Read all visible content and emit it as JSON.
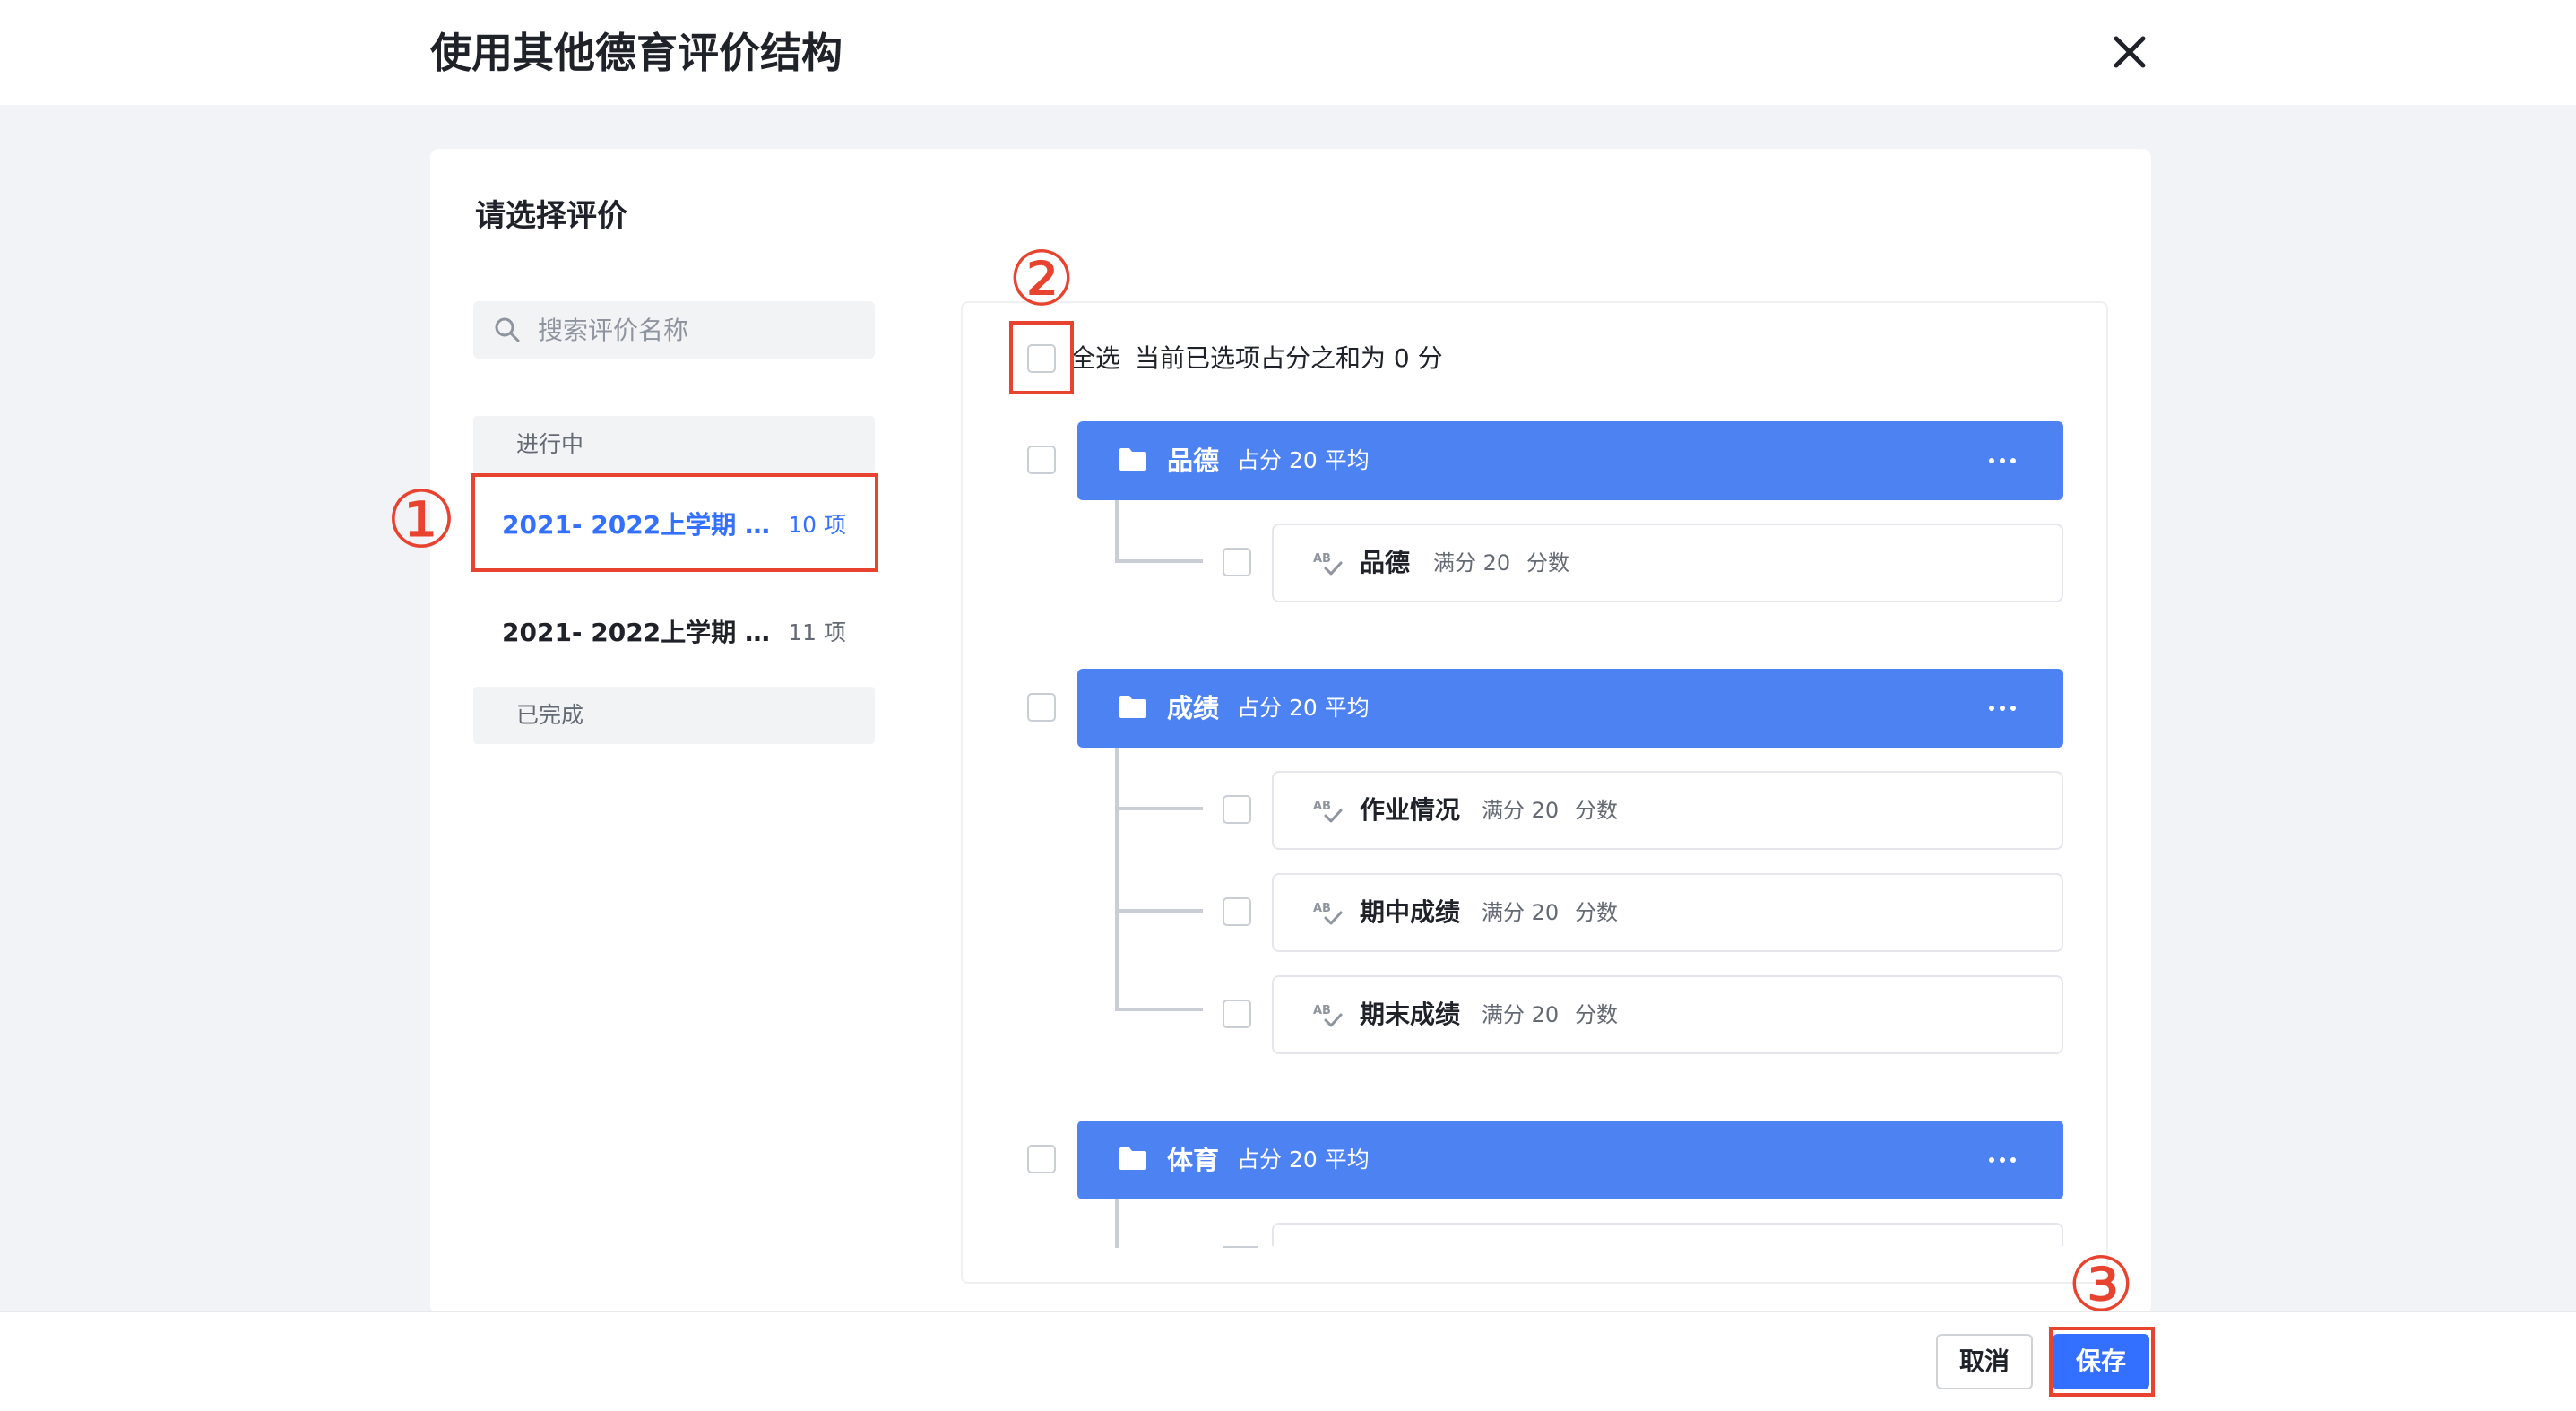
{
  "dialog": {
    "title": "使用其他德育评价结构",
    "close_icon": "close-icon"
  },
  "panel": {
    "title": "请选择评价",
    "search_placeholder": "搜索评价名称"
  },
  "eval_list": {
    "in_progress_label": "进行中",
    "completed_label": "已完成",
    "items": [
      {
        "name": "2021- 2022上学期 德...",
        "count": "10 项",
        "selected": true
      },
      {
        "name": "2021- 2022上学期 德...",
        "count": "11 项",
        "selected": false
      }
    ]
  },
  "tree": {
    "select_all_label": "全选",
    "summary": "当前已选项占分之和为 0 分",
    "groups": [
      {
        "name": "品德",
        "meta": "占分 20 平均",
        "items": [
          {
            "name": "品德",
            "full": "满分 20",
            "type": "分数"
          }
        ]
      },
      {
        "name": "成绩",
        "meta": "占分 20 平均",
        "items": [
          {
            "name": "作业情况",
            "full": "满分 20",
            "type": "分数"
          },
          {
            "name": "期中成绩",
            "full": "满分 20",
            "type": "分数"
          },
          {
            "name": "期末成绩",
            "full": "满分 20",
            "type": "分数"
          }
        ]
      },
      {
        "name": "体育",
        "meta": "占分 20 平均",
        "items": []
      }
    ]
  },
  "annotations": {
    "step1": "①",
    "step2": "②",
    "step3": "③"
  },
  "footer": {
    "cancel_label": "取消",
    "save_label": "保存"
  },
  "colors": {
    "accent": "#3370ff",
    "group_bar": "#4d82f3",
    "annotation": "#e8432f"
  }
}
